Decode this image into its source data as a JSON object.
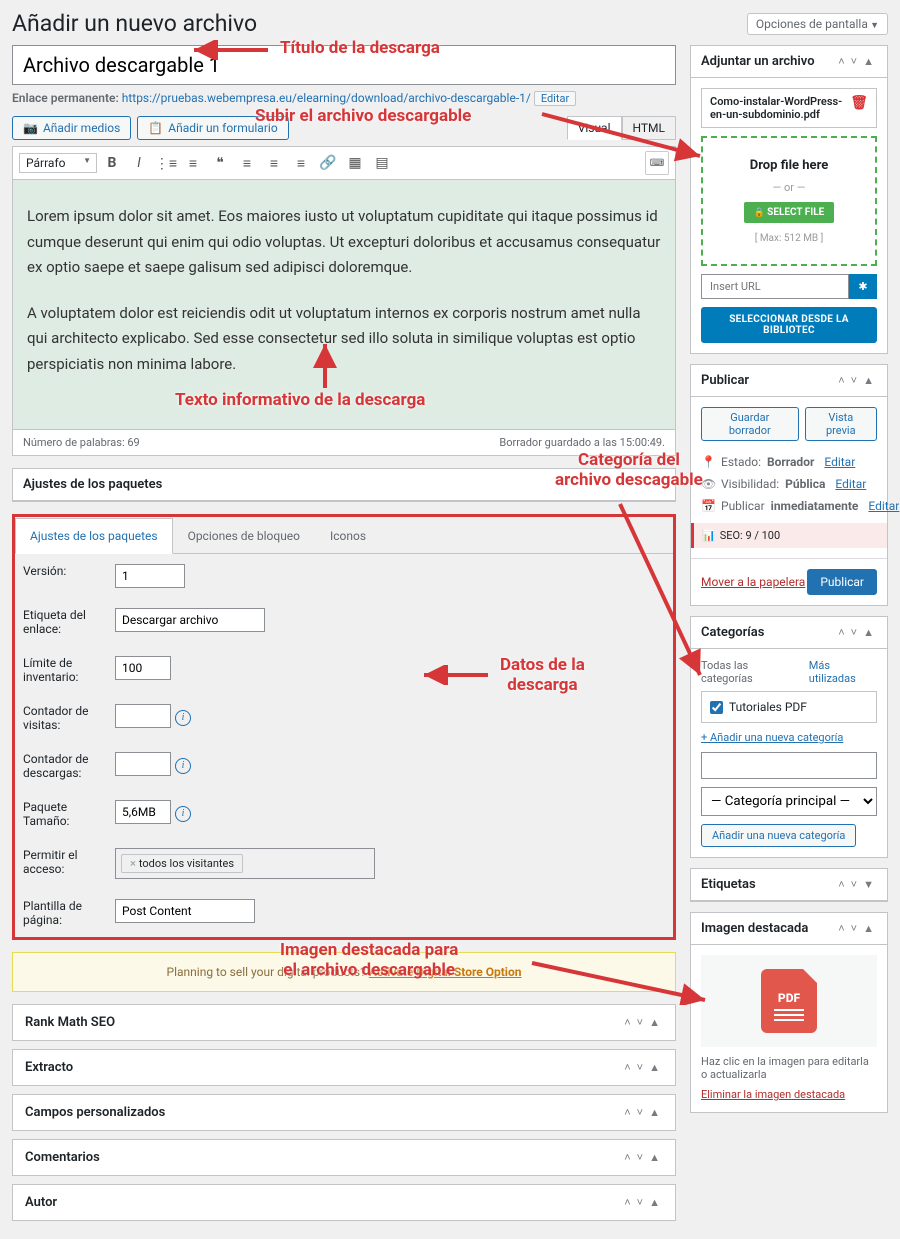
{
  "page_title": "Añadir un nuevo archivo",
  "screen_options": "Opciones de pantalla",
  "title_value": "Archivo descargable 1",
  "permalink": {
    "label": "Enlace permanente:",
    "base": "https://pruebas.webempresa.eu/elearning/download/",
    "slug": "archivo-descargable-1/",
    "edit": "Editar"
  },
  "media_btn": "Añadir medios",
  "form_btn": "Añadir un formulario",
  "editor_tabs": {
    "visual": "Visual",
    "html": "HTML"
  },
  "format_select": "Párrafo",
  "content_p1": "Lorem ipsum dolor sit amet. Eos maiores iusto ut voluptatum cupiditate qui itaque possimus id cumque deserunt qui enim qui odio voluptas. Ut excepturi doloribus et accusamus consequatur ex optio saepe et saepe galisum sed adipisci doloremque.",
  "content_p2": "A voluptatem dolor est reiciendis odit ut voluptatum internos ex corporis nostrum amet nulla qui architecto explicabo. Sed esse consectetur sed illo soluta in similique voluptas est optio perspiciatis non minima labore.",
  "word_count": "Número de palabras: 69",
  "saved_at": "Borrador guardado a las 15:00:49.",
  "package": {
    "title": "Ajustes de los paquetes",
    "tabs": {
      "settings": "Ajustes de los paquetes",
      "lock": "Opciones de bloqueo",
      "icons": "Iconos"
    },
    "fields": {
      "version": {
        "label": "Versión:",
        "value": "1"
      },
      "link_label": {
        "label": "Etiqueta del enlace:",
        "value": "Descargar archivo"
      },
      "stock": {
        "label": "Límite de inventario:",
        "value": "100"
      },
      "views": {
        "label": "Contador de visitas:",
        "value": ""
      },
      "downloads": {
        "label": "Contador de descargas:",
        "value": ""
      },
      "size": {
        "label": "Paquete Tamaño:",
        "value": "5,6MB"
      },
      "access": {
        "label": "Permitir el acceso:",
        "chip": "todos los visitantes"
      },
      "template": {
        "label": "Plantilla de página:",
        "value": "Post Content"
      }
    }
  },
  "store_notice": {
    "pre": "Planning to sell your digital products? ",
    "link": "Activate Digital Store Option"
  },
  "boxes": {
    "rank": "Rank Math SEO",
    "excerpt": "Extracto",
    "custom": "Campos personalizados",
    "comments": "Comentarios",
    "author": "Autor"
  },
  "attach": {
    "title": "Adjuntar un archivo",
    "file": "Como-instalar-WordPress-en-un-subdominio.pdf",
    "drop": "Drop file here",
    "or": "— or —",
    "select": "SELECT FILE",
    "max": "[ Max: 512 MB ]",
    "url_placeholder": "Insert URL",
    "url_btn": "✿",
    "library": "SELECCIONAR DESDE LA BIBLIOTEC"
  },
  "publish": {
    "title": "Publicar",
    "save": "Guardar borrador",
    "preview": "Vista previa",
    "status_label": "Estado:",
    "status": "Borrador",
    "vis_label": "Visibilidad:",
    "vis": "Pública",
    "sched_label": "Publicar",
    "sched": "inmediatamente",
    "edit": "Editar",
    "seo": "SEO: 9 / 100",
    "trash": "Mover a la papelera",
    "publish": "Publicar"
  },
  "categories": {
    "title": "Categorías",
    "tab_all": "Todas las categorías",
    "tab_used": "Más utilizadas",
    "item": "Tutoriales PDF",
    "add_link": "+ Añadir una nueva categoría",
    "parent": "— Categoría principal —",
    "add_btn": "Añadir una nueva categoría"
  },
  "tags": {
    "title": "Etiquetas"
  },
  "featured": {
    "title": "Imagen destacada",
    "caption": "Haz clic en la imagen para editarla o actualizarla",
    "remove": "Eliminar la imagen destacada"
  },
  "annotations": {
    "a1": "Título de la descarga",
    "a2": "Subir el archivo descargable",
    "a3": "Texto informativo de la descarga",
    "a4": "Categoría del\narchivo descagable",
    "a5": "Datos de la\ndescarga",
    "a6": "Imagen destacada para\nel archivo descargable"
  }
}
